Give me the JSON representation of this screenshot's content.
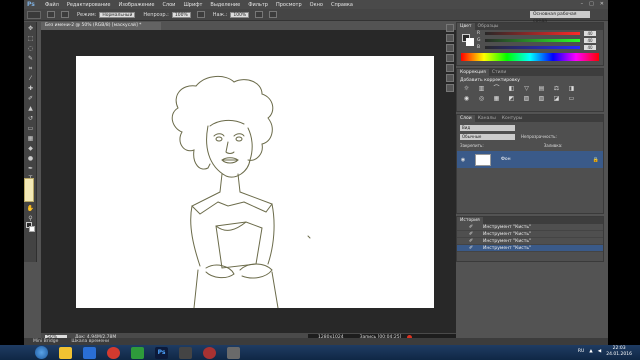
{
  "menubar": {
    "logo": "Ps",
    "items": [
      "Файл",
      "Редактирование",
      "Изображение",
      "Слои",
      "Шрифт",
      "Выделение",
      "Фильтр",
      "Просмотр",
      "Окно",
      "Справка"
    ],
    "win_controls": [
      "–",
      "□",
      "✕"
    ]
  },
  "options": {
    "mode_label": "Режим:",
    "mode_value": "Нормальный",
    "opacity_label": "Непрозр.:",
    "opacity_value": "100%",
    "flow_label": "Наж.:",
    "flow_value": "100%",
    "workspace": "Основная рабочая среда"
  },
  "document": {
    "tab_title": "Без имени-2 @ 50% (RGB/8) [маскуслй] *",
    "zoom": "50%",
    "doc_info": "Док: 4,94M/2,78M",
    "rec_dims": "1280x1024",
    "rec_time": "Запись [00:04:25]"
  },
  "panels": {
    "color": {
      "tabs": [
        "Цвет",
        "Образцы"
      ],
      "rows": [
        {
          "label": "R",
          "value": "40"
        },
        {
          "label": "G",
          "value": "40"
        },
        {
          "label": "B",
          "value": "40"
        }
      ]
    },
    "adjustments": {
      "tabs": [
        "Коррекция",
        "Стили"
      ],
      "title": "Добавить корректировку"
    },
    "layers": {
      "tabs": [
        "Слои",
        "Каналы",
        "Контуры"
      ],
      "kind": "Вид",
      "blend": "Обычные",
      "opacity_label": "Непрозрачность:",
      "lock_label": "Закрепить:",
      "fill_label": "Заливка:",
      "layer_name": "Фон"
    },
    "history": {
      "tabs": [
        "История"
      ],
      "items": [
        "Инструмент \"Кисть\"",
        "Инструмент \"Кисть\"",
        "Инструмент \"Кисть\"",
        "Инструмент \"Кисть\""
      ]
    }
  },
  "mini_bridge": {
    "tabs": [
      "Mini Bridge",
      "Шкала времени"
    ]
  },
  "taskbar": {
    "lang": "RU",
    "time": "22:03",
    "date": "24.01.2016"
  }
}
